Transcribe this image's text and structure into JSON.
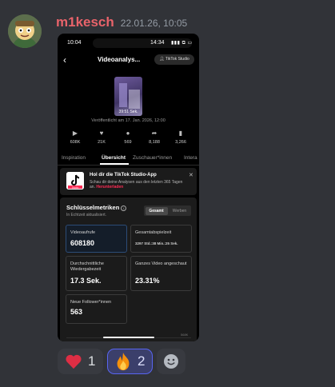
{
  "message": {
    "username": "m1kesch",
    "timestamp": "22.01.26, 10:05",
    "avatar": "avatar"
  },
  "phone": {
    "status_time_left": "10:04",
    "status_time_right": "14:34",
    "status_icons": "▮▮▮ ⧉ ▭",
    "back_icon": "chevron-left-icon",
    "title": "Videoanalys...",
    "studio_button": "TikTok Studio",
    "thumbnail_duration": "39:51 Sek.",
    "published": "Veröffentlicht am 17. Jan. 2026, 12:00",
    "stats": [
      {
        "icon": "play-icon",
        "value": "608K"
      },
      {
        "icon": "heart-icon",
        "value": "21K"
      },
      {
        "icon": "comment-icon",
        "value": "569"
      },
      {
        "icon": "share-icon",
        "value": "8,188"
      },
      {
        "icon": "bookmark-icon",
        "value": "3,266"
      }
    ],
    "tabs": [
      "Inspiration",
      "Übersicht",
      "Zuschauer*innen",
      "Intera"
    ],
    "active_tab": "Übersicht",
    "promo": {
      "title": "Hol dir die TikTok Studio-App",
      "text": "Schau dir deine Analysen aus den letzten 365 Tagen an.",
      "link": "Herunterladen",
      "logo_caption": "Studio"
    },
    "metrics": {
      "title": "Schlüsselmetriken",
      "subtitle": "In Echtzeit aktualisiert.",
      "toggle": [
        "Gesamt",
        "Werben"
      ],
      "cards": [
        {
          "label": "Videoaufrufe",
          "value": "608180"
        },
        {
          "label": "Gesamtabspielzeit",
          "value": "3297 Std.:38 Min.:25 Sek."
        },
        {
          "label": "Durchschnittliche Wiedergabezeit",
          "value": "17.3 Sek."
        },
        {
          "label": "Ganzes Video angeschaut",
          "value": "23.31%"
        },
        {
          "label": "Neue Follower*innen",
          "value": "563"
        }
      ],
      "axis_label": "568K"
    }
  },
  "reactions": [
    {
      "emoji": "heart",
      "count": "1",
      "active": false
    },
    {
      "emoji": "fire",
      "count": "2",
      "active": true
    },
    {
      "emoji": "add-reaction",
      "count": "",
      "active": false
    }
  ],
  "colors": {
    "background": "#313338",
    "username": "#e8636a",
    "tiktok_red": "#fe2c55",
    "reaction_active_border": "#5865f2"
  }
}
